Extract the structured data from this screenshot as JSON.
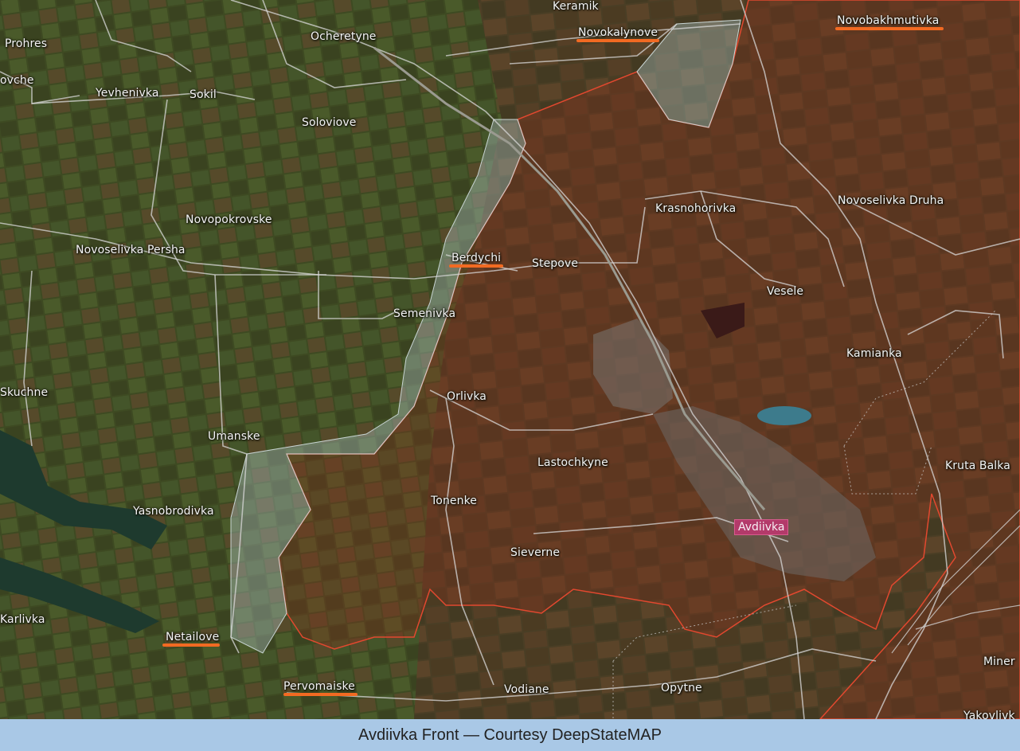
{
  "caption": "Avdiivka Front — Courtesy DeepStateMAP",
  "colors": {
    "highlight": "#f26a22",
    "occupied_fill": "#8a2f1c",
    "frontline": "#e2482f",
    "contested_fill": "#9fb4b0",
    "city_badge": "#b33a6a",
    "road": "#d8d8d8"
  },
  "places": {
    "keramik": "Keramik",
    "novokalynove": "Novokalynove",
    "novobakhmutivka": "Novobakhmutivka",
    "prohres": "Prohres",
    "ocheretyne": "Ocheretyne",
    "ovche": "ovche",
    "yevhenivka": "Yevhenivka",
    "sokil": "Sokil",
    "soloviove": "Soloviove",
    "krasnohorivka": "Krasnohorivka",
    "novoselivka_druha": "Novoselivka Druha",
    "novopokrovske": "Novopokrovske",
    "novoselivka_persha": "Novoselivka Persha",
    "berdychi": "Berdychi",
    "stepove": "Stepove",
    "vesele": "Vesele",
    "semenivka": "Semenivka",
    "kamianka": "Kamianka",
    "skuchne": "Skuchne",
    "orlivka": "Orlivka",
    "umanske": "Umanske",
    "lastochkyne": "Lastochkyne",
    "kruta_balka": "Kruta Balka",
    "tonenke": "Tonenke",
    "yasnobrodivka": "Yasnobrodivka",
    "avdiivka": "Avdiivka",
    "sieverne": "Sieverne",
    "karlivka": "Karlivka",
    "netailove": "Netailove",
    "miner": "Miner",
    "pervomaiske": "Pervomaiske",
    "vodiane": "Vodiane",
    "opytne": "Opytne",
    "yakovlivka": "Yakovlivk"
  }
}
